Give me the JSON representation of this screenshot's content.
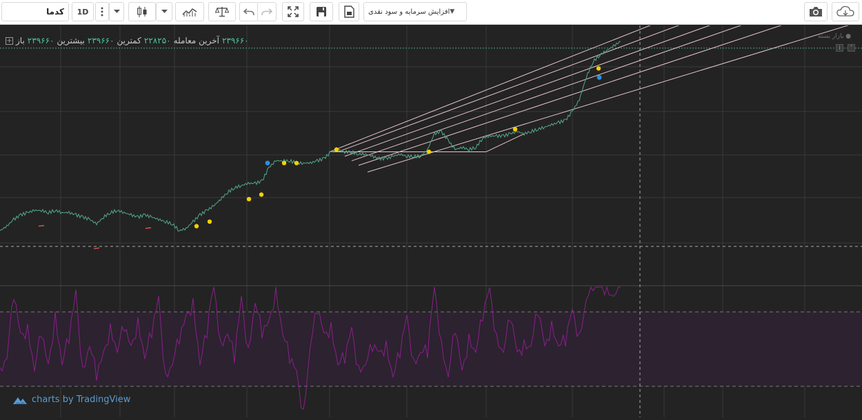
{
  "toolbar": {
    "symbol": "کدما",
    "interval": "1D",
    "layout_name": "افزایش سرمایه و سود نقدی",
    "icons": {
      "more": "more-vertical-icon",
      "interval_caret": "chevron-down-icon",
      "chart_type": "candlestick-icon",
      "chart_type_caret": "chevron-down-icon",
      "indicators": "indicators-icon",
      "compare": "scale-balance-icon",
      "undo": "undo-icon",
      "redo": "redo-icon",
      "fullscreen": "fullscreen-icon",
      "save": "save-icon",
      "load": "load-layout-icon",
      "layout_caret": "chevron-down-icon",
      "snapshot": "camera-icon",
      "cloud": "cloud-download-icon"
    }
  },
  "legend": {
    "open_label": "باز",
    "open_value": "۲۳۹۶۶۰",
    "high_label": "بیشترین",
    "high_value": "۲۳۹۶۶۰",
    "low_label": "کمترین",
    "low_value": "۲۲۸۲۵۰",
    "close_label": "آخرین معامله",
    "close_value": "۲۳۹۶۶۰",
    "toggle_icon": "plus-box-icon"
  },
  "market_status": "بازار بسته",
  "watermark": "charts by TradingView",
  "colors": {
    "background": "#232323",
    "grid": "#3a3a3a",
    "price_line": "#4fa083",
    "down": "#d9534f",
    "channel": "#e8c4cc",
    "marker_yellow": "#f5d000",
    "marker_blue": "#2d8fe0",
    "oscillator": "#8a1f8c",
    "oscillator_band": "#2d2230",
    "legend_value": "#4fc3a1",
    "legend_label": "#c8c8c8"
  },
  "chart_data": {
    "type": "line",
    "price_series": {
      "x": [
        0,
        10,
        20,
        30,
        40,
        50,
        60,
        70,
        80,
        90,
        100,
        110,
        120,
        130,
        140,
        150,
        160,
        170,
        180,
        190,
        200,
        210,
        220,
        230,
        240,
        250,
        260,
        270,
        280,
        290,
        300,
        310,
        320,
        330,
        340,
        350,
        360,
        370,
        380,
        390,
        400,
        410,
        420,
        430,
        440,
        450,
        460,
        470,
        480,
        490,
        500,
        510,
        520,
        530,
        540,
        550,
        560,
        570,
        580,
        590,
        600,
        610,
        620,
        630,
        640,
        650,
        660,
        670,
        680,
        690,
        700,
        710,
        720,
        730,
        740,
        750,
        760,
        770,
        780,
        790,
        800,
        810,
        820,
        830,
        840,
        850,
        860,
        870,
        880,
        890,
        900
      ],
      "y": [
        22,
        24,
        27,
        29,
        30,
        31,
        31,
        30,
        31,
        30,
        30,
        29,
        28,
        27,
        25,
        28,
        30,
        31,
        30,
        29,
        28,
        29,
        28,
        27,
        26,
        25,
        22,
        23,
        26,
        29,
        31,
        33,
        36,
        39,
        41,
        42,
        43,
        43,
        44,
        50,
        53,
        53,
        53,
        52,
        52,
        52,
        53,
        54,
        57,
        58,
        57,
        57,
        56,
        56,
        55,
        54,
        54,
        55,
        56,
        55,
        55,
        55,
        58,
        65,
        66,
        62,
        58,
        59,
        58,
        59,
        63,
        64,
        64,
        64,
        65,
        66,
        65,
        66,
        67,
        68,
        69,
        70,
        71,
        75,
        80,
        90,
        97,
        100,
        102,
        104,
        106
      ]
    },
    "down_ticks": [
      {
        "x": 60,
        "y": 24
      },
      {
        "x": 140,
        "y": 14
      },
      {
        "x": 215,
        "y": 23
      }
    ],
    "markers_yellow": [
      {
        "x": 285,
        "y": 24
      },
      {
        "x": 304,
        "y": 26
      },
      {
        "x": 361,
        "y": 36
      },
      {
        "x": 379,
        "y": 38
      },
      {
        "x": 412,
        "y": 52
      },
      {
        "x": 430,
        "y": 52
      },
      {
        "x": 488,
        "y": 58
      },
      {
        "x": 622,
        "y": 57
      },
      {
        "x": 747,
        "y": 67
      },
      {
        "x": 868,
        "y": 94
      }
    ],
    "markers_blue": [
      {
        "x": 388,
        "y": 52
      },
      {
        "x": 869,
        "y": 90
      }
    ],
    "channel_lines": [
      {
        "x1": 478,
        "y1": 57,
        "x2": 1083,
        "y2": 130
      },
      {
        "x1": 490,
        "y1": 57,
        "x2": 1133,
        "y2": 130
      },
      {
        "x1": 500,
        "y1": 55,
        "x2": 1183,
        "y2": 130
      },
      {
        "x1": 510,
        "y1": 53,
        "x2": 1233,
        "y2": 130
      },
      {
        "x1": 520,
        "y1": 51,
        "x2": 1250,
        "y2": 125
      },
      {
        "x1": 533,
        "y1": 48,
        "x2": 1250,
        "y2": 115
      }
    ],
    "channel_bottom": {
      "x1": 478,
      "y1": 57,
      "x2": 705,
      "y2": 57
    },
    "channel_side": {
      "x1": 705,
      "y1": 57,
      "x2": 760,
      "y2": 65
    },
    "current_price": 103,
    "y_range": [
      0,
      110
    ],
    "x_range": [
      0,
      1250
    ],
    "crosshair_x": 928,
    "crosshair_price": 15,
    "oscillator": {
      "upper_band": 80,
      "lower_band": 20,
      "range": [
        0,
        100
      ],
      "x": [
        0,
        10,
        20,
        30,
        40,
        50,
        60,
        70,
        80,
        90,
        100,
        110,
        120,
        130,
        140,
        150,
        160,
        170,
        180,
        190,
        200,
        210,
        220,
        230,
        240,
        250,
        260,
        270,
        280,
        290,
        300,
        310,
        320,
        330,
        340,
        350,
        360,
        370,
        380,
        390,
        400,
        410,
        420,
        430,
        440,
        450,
        460,
        470,
        480,
        490,
        500,
        510,
        520,
        530,
        540,
        550,
        560,
        570,
        580,
        590,
        600,
        610,
        620,
        630,
        640,
        650,
        660,
        670,
        680,
        690,
        700,
        710,
        720,
        730,
        740,
        750,
        760,
        770,
        780,
        790,
        800,
        810,
        820,
        830,
        840,
        850,
        860,
        870,
        880,
        890,
        900
      ],
      "y": [
        35,
        50,
        90,
        55,
        70,
        40,
        60,
        30,
        80,
        45,
        55,
        90,
        35,
        60,
        25,
        40,
        70,
        55,
        65,
        45,
        75,
        50,
        60,
        85,
        30,
        45,
        55,
        70,
        90,
        45,
        60,
        100,
        55,
        70,
        40,
        85,
        50,
        95,
        60,
        65,
        100,
        70,
        40,
        25,
        0,
        60,
        80,
        55,
        70,
        45,
        40,
        60,
        35,
        45,
        50,
        40,
        55,
        35,
        45,
        70,
        40,
        55,
        45,
        95,
        55,
        35,
        65,
        25,
        60,
        55,
        75,
        92,
        60,
        55,
        75,
        40,
        55,
        60,
        80,
        45,
        70,
        60,
        55,
        75,
        60,
        97,
        100,
        95,
        100,
        100,
        100
      ]
    }
  }
}
